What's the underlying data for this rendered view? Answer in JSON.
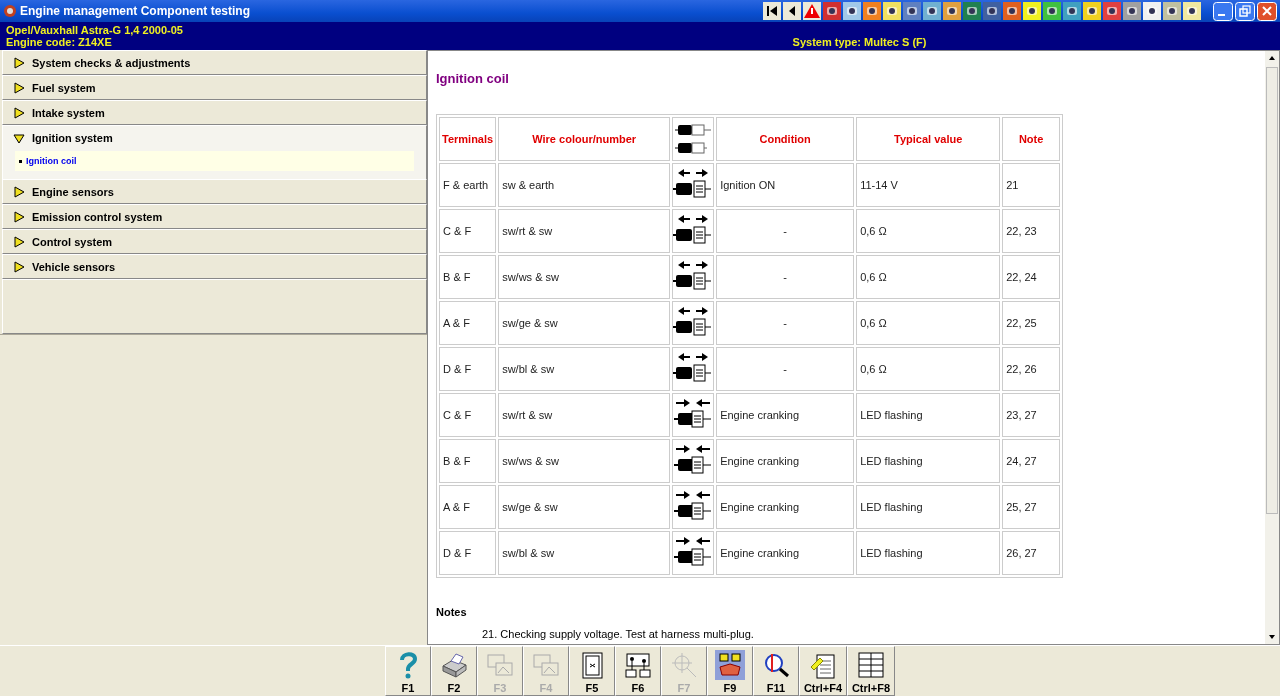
{
  "window": {
    "title": "Engine management Component testing"
  },
  "header": {
    "vehicle": "Opel/Vauxhall  Astra-G  1,4  2000-05",
    "engine_code": "Engine code: Z14XE",
    "system_type": "System type: Multec S (F)"
  },
  "sidebar": {
    "items": [
      {
        "label": "System checks & adjustments",
        "expanded": false
      },
      {
        "label": "Fuel system",
        "expanded": false
      },
      {
        "label": "Intake system",
        "expanded": false
      },
      {
        "label": "Ignition system",
        "expanded": true,
        "children": [
          {
            "label": "Ignition coil",
            "selected": true
          }
        ]
      },
      {
        "label": "Engine sensors",
        "expanded": false
      },
      {
        "label": "Emission control system",
        "expanded": false
      },
      {
        "label": "Control system",
        "expanded": false
      },
      {
        "label": "Vehicle sensors",
        "expanded": false
      }
    ]
  },
  "content": {
    "heading": "Ignition coil",
    "table": {
      "columns": [
        "Terminals",
        "Wire colour/number",
        "Condition",
        "Typical value",
        "Note"
      ],
      "rows": [
        {
          "terminals": "F & earth",
          "wire": "sw & earth",
          "kind": "separated",
          "condition": "Ignition ON",
          "value": "11-14 V",
          "note": "21"
        },
        {
          "terminals": "C & F",
          "wire": "sw/rt & sw",
          "kind": "separated",
          "condition": "-",
          "value": "0,6 Ω",
          "note": "22, 23"
        },
        {
          "terminals": "B & F",
          "wire": "sw/ws & sw",
          "kind": "separated",
          "condition": "-",
          "value": "0,6 Ω",
          "note": "22, 24"
        },
        {
          "terminals": "A & F",
          "wire": "sw/ge & sw",
          "kind": "separated",
          "condition": "-",
          "value": "0,6 Ω",
          "note": "22, 25"
        },
        {
          "terminals": "D & F",
          "wire": "sw/bl & sw",
          "kind": "separated",
          "condition": "-",
          "value": "0,6 Ω",
          "note": "22, 26"
        },
        {
          "terminals": "C & F",
          "wire": "sw/rt & sw",
          "kind": "joined",
          "condition": "Engine cranking",
          "value": "LED flashing",
          "note": "23, 27"
        },
        {
          "terminals": "B & F",
          "wire": "sw/ws & sw",
          "kind": "joined",
          "condition": "Engine cranking",
          "value": "LED flashing",
          "note": "24, 27"
        },
        {
          "terminals": "A & F",
          "wire": "sw/ge & sw",
          "kind": "joined",
          "condition": "Engine cranking",
          "value": "LED flashing",
          "note": "25, 27"
        },
        {
          "terminals": "D & F",
          "wire": "sw/bl & sw",
          "kind": "joined",
          "condition": "Engine cranking",
          "value": "LED flashing",
          "note": "26, 27"
        }
      ]
    },
    "notes_heading": "Notes",
    "notes": [
      "21. Checking supply voltage. Test at harness multi-plug."
    ]
  },
  "function_keys": [
    {
      "label": "F1",
      "kind": "help",
      "disabled": false,
      "selected": false
    },
    {
      "label": "F2",
      "kind": "print",
      "disabled": false,
      "selected": false
    },
    {
      "label": "F3",
      "kind": "pictures",
      "disabled": true,
      "selected": false
    },
    {
      "label": "F4",
      "kind": "pictures",
      "disabled": true,
      "selected": false
    },
    {
      "label": "F5",
      "kind": "page",
      "disabled": false,
      "selected": false
    },
    {
      "label": "F6",
      "kind": "circuit",
      "disabled": false,
      "selected": false
    },
    {
      "label": "F7",
      "kind": "crosshair",
      "disabled": true,
      "selected": false
    },
    {
      "label": "F9",
      "kind": "map",
      "disabled": false,
      "selected": true
    },
    {
      "label": "F11",
      "kind": "magnifier",
      "disabled": false,
      "selected": false
    },
    {
      "label": "Ctrl+F4",
      "kind": "notes",
      "disabled": false,
      "selected": false
    },
    {
      "label": "Ctrl+F8",
      "kind": "list",
      "disabled": false,
      "selected": false
    }
  ]
}
